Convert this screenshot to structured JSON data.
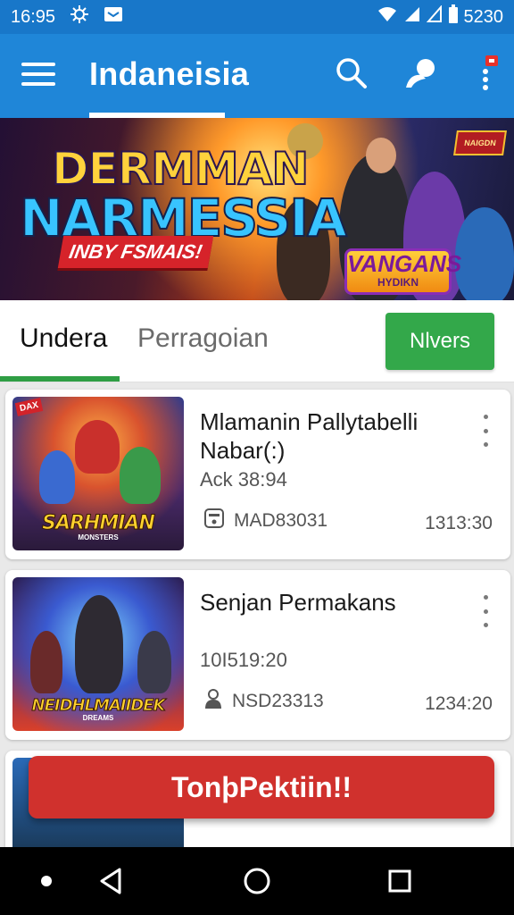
{
  "status_bar": {
    "time": "16:95",
    "battery": "5230"
  },
  "app_bar": {
    "title": "Indaneisia"
  },
  "banner": {
    "headline_line1": "DERMMAN",
    "headline_line2": "NARMESSIA",
    "subtitle": "INBY FSMAIS!",
    "badge_title": "VANGANS",
    "badge_subtitle": "HYDIKN",
    "logo_text": "NAIGDN"
  },
  "tabs": {
    "active": "Undera",
    "inactive": "Perragoian",
    "action_button": "Nlvers"
  },
  "cards": [
    {
      "title": "Mlamanin Pallytabelli Nabar(:)",
      "subtitle": "Ack 38:94",
      "meta_left": "MAD83031",
      "meta_right": "1313:30",
      "thumb_title": "SARHMIAN",
      "thumb_sub": "MONSTERS",
      "thumb_corner": "DAX"
    },
    {
      "title": "Senjan Permakans",
      "subtitle": "10I519:20",
      "meta_left": "NSD23313",
      "meta_right": "1234:20",
      "thumb_title": "NEIDHLMAIIDEK",
      "thumb_sub": "DREAMS"
    }
  ],
  "toast": {
    "label": "TonþPektiin!!"
  },
  "colors": {
    "app_bar": "#1f86d8",
    "status_bar": "#1877c9",
    "tab_indicator": "#2f9e44",
    "action_button": "#33a84a",
    "toast": "#d0312d"
  },
  "icons": {
    "app_bar": [
      "menu-icon",
      "search-icon",
      "profile-icon",
      "more-vert-icon"
    ],
    "navbar": [
      "back-icon",
      "home-icon",
      "recents-icon"
    ]
  }
}
